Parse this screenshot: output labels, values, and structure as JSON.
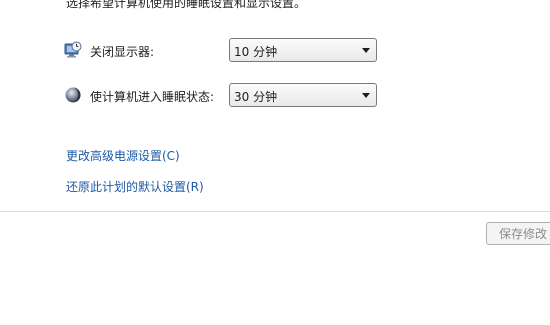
{
  "intro_text": "选择希望计算机使用的睡眠设置和显示设置。",
  "display_off": {
    "icon": "monitor-clock-icon",
    "label": "关闭显示器:",
    "value": "10 分钟"
  },
  "sleep": {
    "icon": "moon-icon",
    "label": "使计算机进入睡眠状态:",
    "value": "30 分钟"
  },
  "links": {
    "advanced": "更改高级电源设置(C)",
    "restore": "还原此计划的默认设置(R)"
  },
  "buttons": {
    "save": "保存修改"
  },
  "colors": {
    "link": "#1e5aa8",
    "disabled_text": "#8d8d8d"
  }
}
